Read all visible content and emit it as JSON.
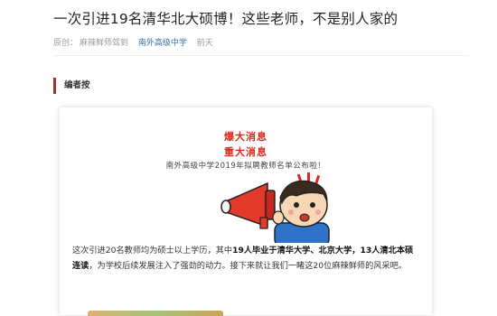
{
  "article": {
    "title": "一次引进19名清华北大硕博！这些老师，不是别人家的",
    "meta": {
      "source_label": "原创：",
      "author": "麻辣鲜师驾到",
      "account": "南外高级中学",
      "time": "前天"
    },
    "editor_label": "编者按"
  },
  "card": {
    "headline_1": "爆大消息",
    "headline_2": "重大消息",
    "subline": "南外高级中学2019年拟聘教师名单公布啦！",
    "body": {
      "p1": "这次引进20名教师均为硕士以上学历，其中",
      "b1": "19人毕业于清华大学、北京大学，13人清北本硕连读",
      "p2": "，为学校后续发展注入了强劲的动力。接下来就让我们一睹这20位麻辣鲜师的风采吧。"
    }
  },
  "colors": {
    "accent_red": "#e0271c",
    "label_bar": "#a8302a",
    "link_blue": "#3a6fb0"
  }
}
